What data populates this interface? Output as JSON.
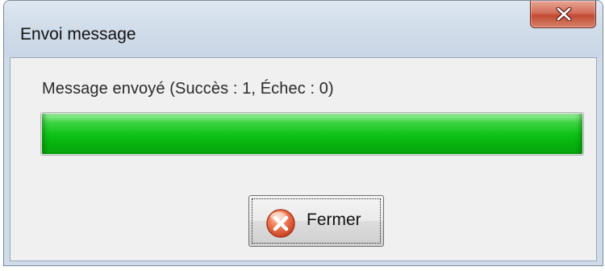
{
  "window": {
    "title": "Envoi message",
    "close_icon": "close-x-icon"
  },
  "message": {
    "text": "Message envoyé (Succès : 1, Échec : 0)"
  },
  "progress": {
    "value_percent": 100,
    "fill_color": "#10c419"
  },
  "buttons": {
    "close_label": "Fermer",
    "close_icon": "cancel-circle-icon",
    "close_focused": true
  }
}
